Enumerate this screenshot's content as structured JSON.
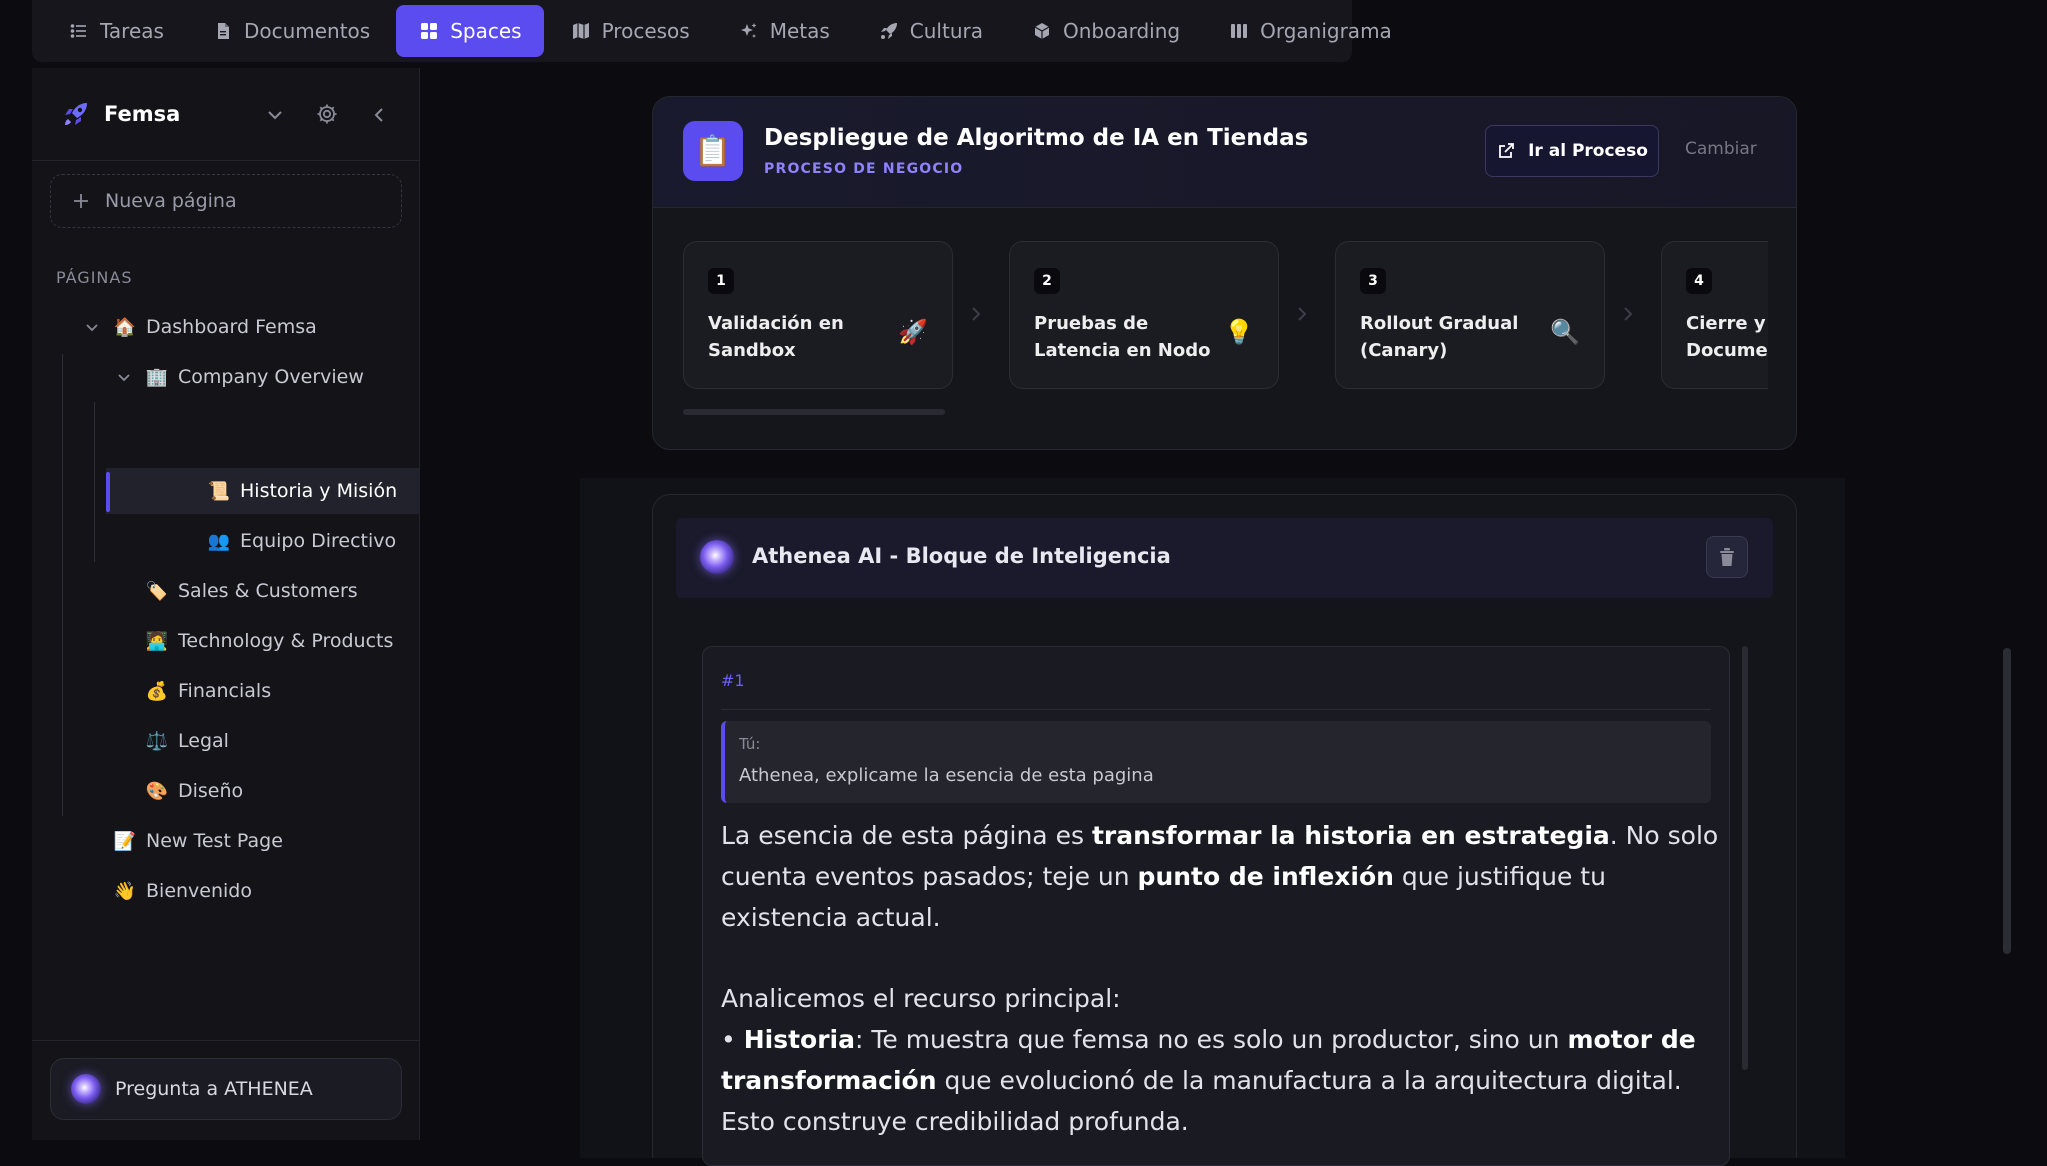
{
  "nav": {
    "tabs": [
      {
        "label": "Tareas",
        "icon": "list-icon"
      },
      {
        "label": "Documentos",
        "icon": "document-icon"
      },
      {
        "label": "Spaces",
        "icon": "grid-icon",
        "active": true
      },
      {
        "label": "Procesos",
        "icon": "map-icon"
      },
      {
        "label": "Metas",
        "icon": "sparkles-icon"
      },
      {
        "label": "Cultura",
        "icon": "rocket-icon"
      },
      {
        "label": "Onboarding",
        "icon": "box-icon"
      },
      {
        "label": "Organigrama",
        "icon": "columns-icon"
      }
    ]
  },
  "sidebar": {
    "workspace": "Femsa",
    "new_page": "Nueva página",
    "section_label": "PÁGINAS",
    "items": [
      {
        "label": "Dashboard Femsa",
        "emoji": "🏠"
      },
      {
        "label": "Company Overview",
        "emoji": "🏢"
      },
      {
        "label": "Historia y Misión",
        "emoji": "📜"
      },
      {
        "label": "Equipo Directivo",
        "emoji": "👥"
      },
      {
        "label": "Sales & Customers",
        "emoji": "🏷️"
      },
      {
        "label": "Technology & Products",
        "emoji": "🧑‍💻"
      },
      {
        "label": "Financials",
        "emoji": "💰"
      },
      {
        "label": "Legal",
        "emoji": "⚖️"
      },
      {
        "label": "Diseño",
        "emoji": "🎨"
      },
      {
        "label": "New Test Page",
        "emoji": "📝"
      },
      {
        "label": "Bienvenido",
        "emoji": "👋"
      }
    ],
    "ask_label": "Pregunta a ATHENEA"
  },
  "process": {
    "icon": "📋",
    "title": "Despliegue de Algoritmo de IA en Tiendas",
    "subtitle": "PROCESO DE NEGOCIO",
    "go_button": "Ir al Proceso",
    "change_button": "Cambiar",
    "steps": [
      {
        "num": "1",
        "label": "Validación en Sandbox",
        "icon": "🚀"
      },
      {
        "num": "2",
        "label": "Pruebas de Latencia en Nodo",
        "icon": "💡"
      },
      {
        "num": "3",
        "label": "Rollout Gradual (Canary)",
        "icon": "🔍"
      },
      {
        "num": "4",
        "label": "Cierre y Documen",
        "icon": ""
      }
    ]
  },
  "ai_block": {
    "title": "Athenea AI - Bloque de Inteligencia",
    "message_id": "#1",
    "user_label": "Tú:",
    "user_text": "Athenea, explicame la esencia de esta pagina",
    "answer": {
      "p1_a": "La esencia de esta página es ",
      "p1_b": "transformar la historia en estrategia",
      "p1_c": ". No solo cuenta eventos pasados; teje un ",
      "p1_d": "punto de inflexión",
      "p1_e": " que justifique tu existencia actual.",
      "p2": "Analicemos el recurso principal:",
      "p3_a": "• ",
      "p3_b": "Historia",
      "p3_c": ": Te muestra que femsa no es solo un productor, sino un ",
      "p3_d": "motor de transformación",
      "p3_e": " que evolucionó de la manufactura a la arquitectura digital. Esto construye credibilidad profunda."
    }
  },
  "colors": {
    "accent": "#5b4cf0",
    "accent_text": "#8f82ff",
    "background": "#0c0c10",
    "panel": "#131318"
  }
}
